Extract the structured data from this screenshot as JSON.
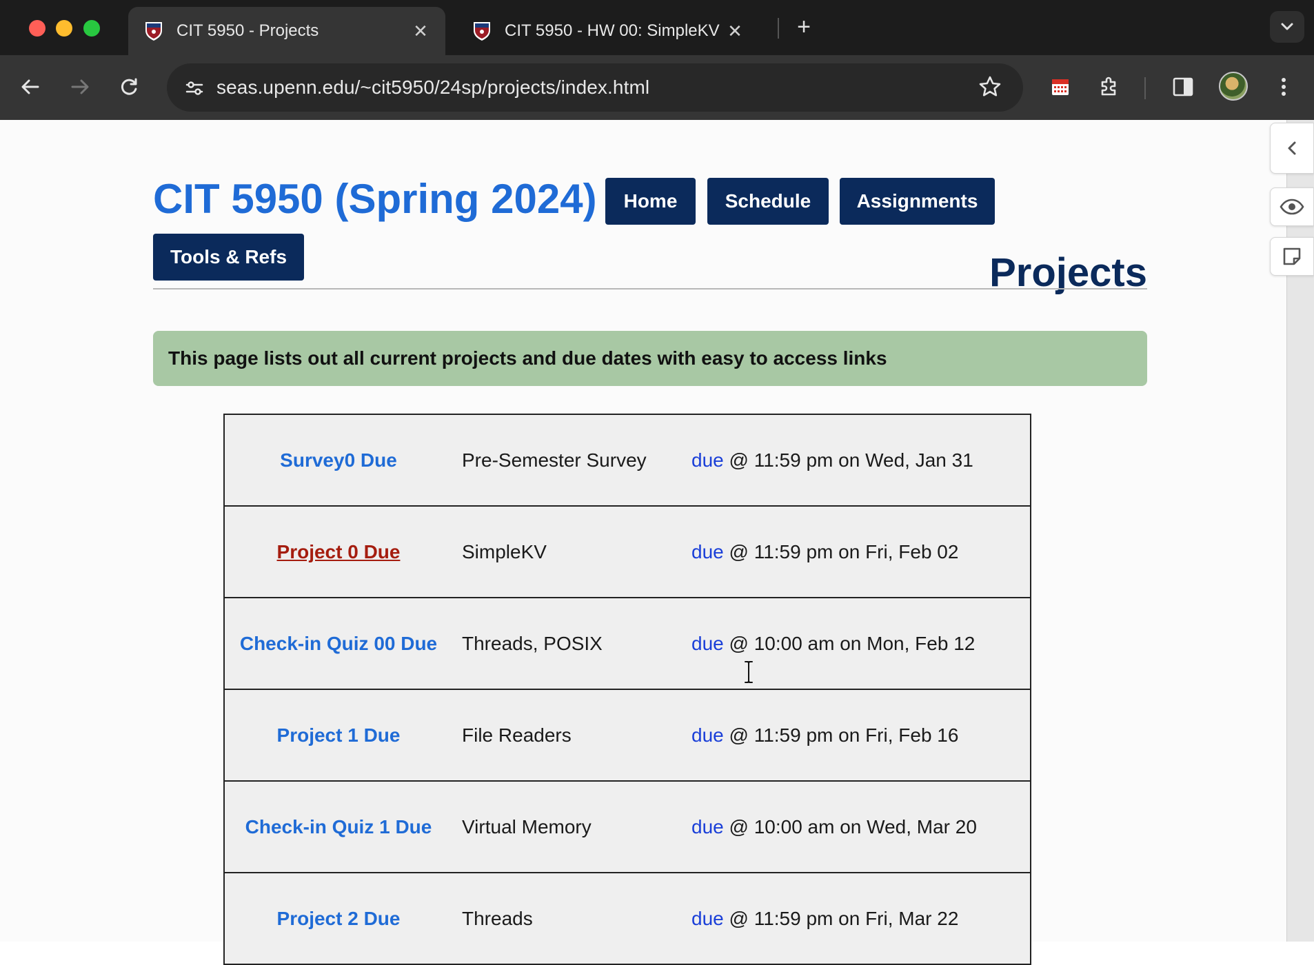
{
  "browser": {
    "tabs": [
      {
        "title": "CIT 5950 - Projects",
        "active": true
      },
      {
        "title": "CIT 5950 - HW 00: SimpleKV",
        "active": false
      }
    ],
    "url": "seas.upenn.edu/~cit5950/24sp/projects/index.html"
  },
  "site": {
    "title": "CIT 5950 (Spring 2024)",
    "nav": {
      "home": "Home",
      "schedule": "Schedule",
      "assignments": "Assignments",
      "tools": "Tools & Refs"
    },
    "page_heading": "Projects",
    "notice": "This page lists out all current projects and due dates with easy to access links"
  },
  "rows": [
    {
      "name": "Survey0 Due",
      "topic": "Pre-Semester Survey",
      "due_link": "due",
      "due_rest": " @ 11:59 pm on Wed, Jan 31"
    },
    {
      "name": "Project 0 Due",
      "topic": "SimpleKV",
      "due_link": "due",
      "due_rest": " @ 11:59 pm on Fri, Feb 02"
    },
    {
      "name": "Check-in Quiz 00 Due",
      "topic": "Threads, POSIX",
      "due_link": "due",
      "due_rest": " @ 10:00 am on Mon, Feb 12"
    },
    {
      "name": "Project 1 Due",
      "topic": "File Readers",
      "due_link": "due",
      "due_rest": " @ 11:59 pm on Fri, Feb 16"
    },
    {
      "name": "Check-in Quiz 1 Due",
      "topic": "Virtual Memory",
      "due_link": "due",
      "due_rest": " @ 10:00 am on Wed, Mar 20"
    },
    {
      "name": "Project 2 Due",
      "topic": "Threads",
      "due_link": "due",
      "due_rest": " @ 11:59 pm on Fri, Mar 22"
    }
  ],
  "colors": {
    "title_blue": "#1f6bd6",
    "nav_navy": "#0b2a5b",
    "notice_green": "#a8c8a4",
    "visited_red": "#a51d0f"
  },
  "icons": [
    "back-icon",
    "forward-icon",
    "reload-icon",
    "site-settings-icon",
    "bookmark-star-icon",
    "calendar-extension-icon",
    "extensions-icon",
    "side-panel-icon",
    "menu-icon",
    "collapse-panel-icon",
    "eye-icon",
    "sticky-note-icon",
    "text-cursor-icon"
  ]
}
